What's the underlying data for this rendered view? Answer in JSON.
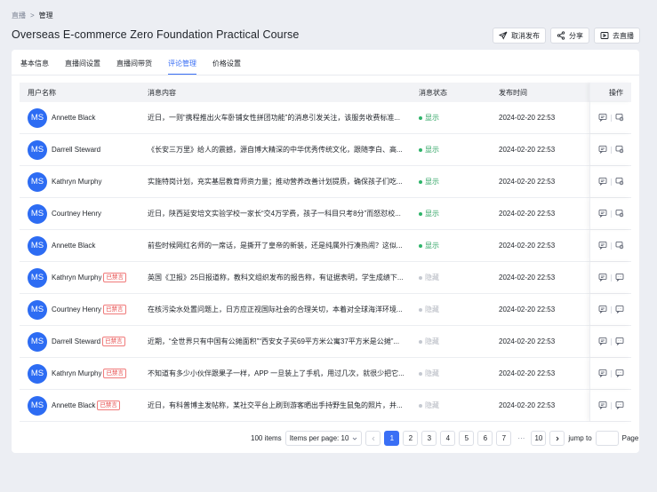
{
  "breadcrumb": {
    "parent": "直播",
    "separator": ">",
    "current": "管理"
  },
  "page_title": "Overseas E-commerce Zero Foundation Practical Course",
  "header_actions": [
    {
      "label": "取消发布",
      "icon": "send-icon"
    },
    {
      "label": "分享",
      "icon": "share-icon"
    },
    {
      "label": "去直播",
      "icon": "live-icon"
    }
  ],
  "tabs": [
    "基本信息",
    "直播间设置",
    "直播间带货",
    "评论管理",
    "价格设置"
  ],
  "active_tab": "评论管理",
  "table": {
    "headers": [
      "用户名称",
      "消息内容",
      "消息状态",
      "发布时间",
      "操作"
    ],
    "rows": [
      {
        "initials": "MS",
        "name": "Annette Black",
        "banned": "",
        "message": "近日，一则“携程推出火车卧铺女性拼团功能”的消息引发关注，该服务收费标准...",
        "status": "显示",
        "status_on": true,
        "time": "2024-02-20 22:53"
      },
      {
        "initials": "MS",
        "name": "Darrell Steward",
        "banned": "",
        "message": "《长安三万里》给人的震撼，源自博大精深的中华优秀传统文化，跟随李白、高...",
        "status": "显示",
        "status_on": true,
        "time": "2024-02-20 22:53"
      },
      {
        "initials": "MS",
        "name": "Kathryn Murphy",
        "banned": "",
        "message": "实施特岗计划，充实基层教育师资力量；推动营养改善计划提质，确保孩子们吃...",
        "status": "显示",
        "status_on": true,
        "time": "2024-02-20 22:53"
      },
      {
        "initials": "MS",
        "name": "Courtney Henry",
        "banned": "",
        "message": "近日，陕西延安培文实验学校一家长“交4万学费，孩子一科目只考8分”而怒怼校...",
        "status": "显示",
        "status_on": true,
        "time": "2024-02-20 22:53"
      },
      {
        "initials": "MS",
        "name": "Annette Black",
        "banned": "",
        "message": "前些时候网红名师的一席话，是撕开了皇帝的新装，还是纯属外行凑热闹？这似...",
        "status": "显示",
        "status_on": true,
        "time": "2024-02-20 22:53"
      },
      {
        "initials": "MS",
        "name": "Kathryn Murphy",
        "banned": "已禁言",
        "message": "英国《卫报》25日报道称，教科文组织发布的报告称，有证据表明，学生成绩下...",
        "status": "隐藏",
        "status_on": false,
        "time": "2024-02-20 22:53"
      },
      {
        "initials": "MS",
        "name": "Courtney Henry",
        "banned": "已禁言",
        "message": "在核污染水处置问题上，日方应正视国际社会的合理关切，本着对全球海洋环境...",
        "status": "隐藏",
        "status_on": false,
        "time": "2024-02-20 22:53"
      },
      {
        "initials": "MS",
        "name": "Darrell Steward",
        "banned": "已禁言",
        "message": "近期，“全世界只有中国有公摊面积”“西安女子买69平方米公寓37平方米是公摊”...",
        "status": "隐藏",
        "status_on": false,
        "time": "2024-02-20 22:53"
      },
      {
        "initials": "MS",
        "name": "Kathryn Murphy",
        "banned": "已禁言",
        "message": "不知道有多少小伙伴跟果子一样，APP 一旦装上了手机，用过几次，就很少把它...",
        "status": "隐藏",
        "status_on": false,
        "time": "2024-02-20 22:53"
      },
      {
        "initials": "MS",
        "name": "Annette Black",
        "banned": "已禁言",
        "message": "近日，有科普博主发帖称，某社交平台上刷到游客晒出手持野生鼠兔的照片，并...",
        "status": "隐藏",
        "status_on": false,
        "time": "2024-02-20 22:53"
      }
    ]
  },
  "pagination": {
    "total": "100 items",
    "per_page": "Items per page: 10",
    "pages": [
      "1",
      "2",
      "3",
      "4",
      "5",
      "6",
      "7",
      "···",
      "10"
    ],
    "current_page": "1",
    "jump_label": "jump to",
    "page_suffix": "Page"
  },
  "colors": {
    "accent": "#3a6ff5",
    "avatar": "#2d6cf3",
    "on": "#2fb46a",
    "banned": "#e54545"
  }
}
